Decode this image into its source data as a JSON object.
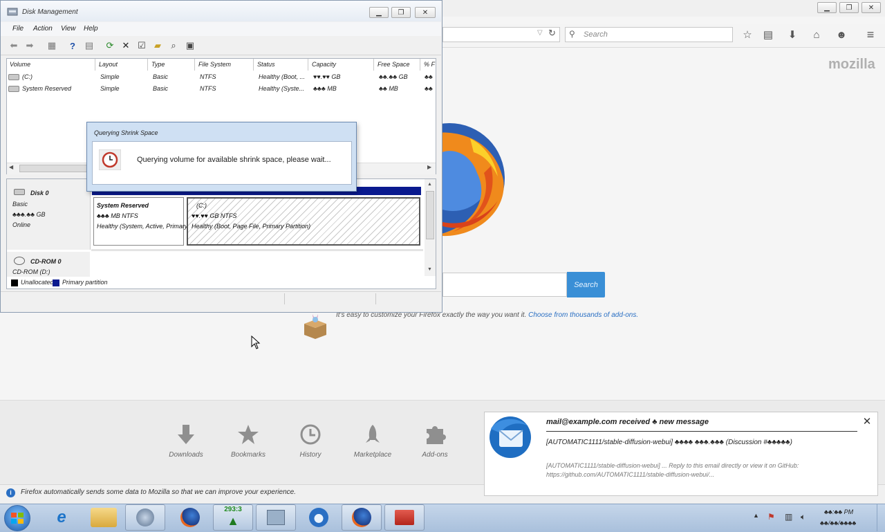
{
  "firefox": {
    "search_placeholder": "Search",
    "brand_word": "mozilla",
    "home_search_button": "Search",
    "addon_text": "It's easy to customize your Firefox exactly the way you want it.",
    "addon_link": "Choose from thousands of add-ons.",
    "launchers": [
      {
        "label": "Downloads",
        "icon": "download-icon"
      },
      {
        "label": "Bookmarks",
        "icon": "star-icon"
      },
      {
        "label": "History",
        "icon": "clock-icon"
      },
      {
        "label": "Marketplace",
        "icon": "rocket-icon"
      },
      {
        "label": "Add-ons",
        "icon": "puzzle-icon"
      }
    ],
    "data_notice": "Firefox automatically sends some data to Mozilla so that we can improve your experience."
  },
  "disk_management": {
    "title": "Disk Management",
    "menu": [
      "File",
      "Action",
      "View",
      "Help"
    ],
    "columns": [
      "Volume",
      "Layout",
      "Type",
      "File System",
      "Status",
      "Capacity",
      "Free Space",
      "% F"
    ],
    "rows": [
      {
        "volume": "(C:)",
        "layout": "Simple",
        "type": "Basic",
        "fs": "NTFS",
        "status": "Healthy (Boot, ...",
        "capacity": "♥♥.♥♥ GB",
        "free": "♣♣.♣♣ GB",
        "pct": "♣♣"
      },
      {
        "volume": "System Reserved",
        "layout": "Simple",
        "type": "Basic",
        "fs": "NTFS",
        "status": "Healthy (Syste...",
        "capacity": "♣♣♣ MB",
        "free": "♣♣ MB",
        "pct": "♣♣"
      }
    ],
    "disk0": {
      "name": "Disk 0",
      "type": "Basic",
      "size": "♣♣♣.♣♣ GB",
      "state": "Online"
    },
    "cdrom": {
      "name": "CD-ROM 0",
      "sub": "CD-ROM (D:)"
    },
    "part1": {
      "name": "System Reserved",
      "size": "♣♣♣ MB NTFS",
      "status": "Healthy (System, Active, Primary"
    },
    "part2": {
      "name": "(C:)",
      "size": "♥♥.♥♥ GB NTFS",
      "status": "Healthy (Boot, Page File, Primary Partition)"
    },
    "legend": [
      {
        "label": "Unallocated",
        "color": "#000000"
      },
      {
        "label": "Primary partition",
        "color": "#0a1a8f"
      }
    ]
  },
  "dialog": {
    "title": "Querying Shrink Space",
    "message": "Querying volume for available shrink space, please wait..."
  },
  "notification": {
    "title": "mail@example.com received ♣ new message",
    "subject": "[AUTOMATIC1111/stable-diffusion-webui] ♣♣♣♣ ♣♣♣.♣♣♣ (Discussion #♣♣♣♣♣)",
    "body": "[AUTOMATIC1111/stable-diffusion-webui] ... Reply to this email directly or view it on GitHub: https://github.com/AUTOMATIC1111/stable-diffusion-webui/..."
  },
  "taskbar": {
    "badge": "293:3",
    "time": "♣♣:♣♣ PM",
    "date": "♣♣/♣♣/♣♣♣♣"
  }
}
